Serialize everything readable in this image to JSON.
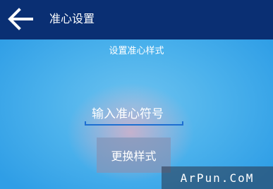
{
  "header": {
    "title": "准心设置",
    "back_icon": "arrow-left-icon"
  },
  "section": {
    "label": "设置准心样式"
  },
  "input": {
    "placeholder": "输入准心符号",
    "value": ""
  },
  "actions": {
    "change_label": "更换样式"
  },
  "watermark": {
    "text": "ArPun.CoM"
  },
  "colors": {
    "topbar": "#0a2f73",
    "accent": "#1d6fd1",
    "background": "#4cb2ec"
  }
}
